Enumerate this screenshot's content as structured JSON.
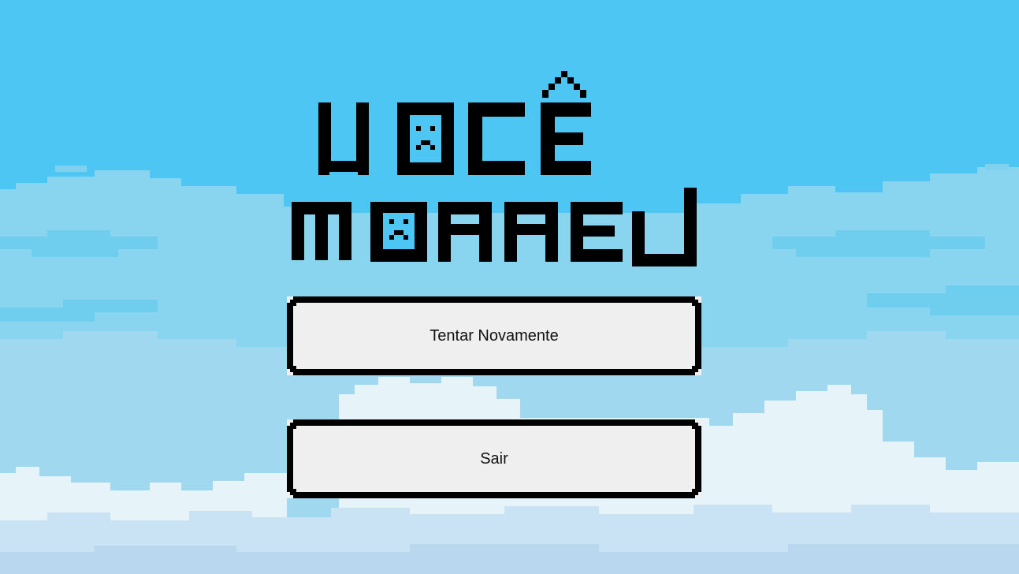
{
  "screen": {
    "title_line1": "VOCÊ",
    "title_line2": "MORREU"
  },
  "buttons": {
    "retry_label": "Tentar Novamente",
    "exit_label": "Sair"
  },
  "colors": {
    "sky": "#4ec6f3",
    "cloud_far": "#89d4ef",
    "cloud_mid": "#a8dcf0",
    "cloud_near": "#e6f3f9",
    "cloud_shadow": "#c9e2f4",
    "ink": "#000000",
    "button_fill": "#efefef"
  },
  "icons": {
    "sad_face_1": "sad-face-icon",
    "sad_face_2": "sad-face-icon"
  }
}
